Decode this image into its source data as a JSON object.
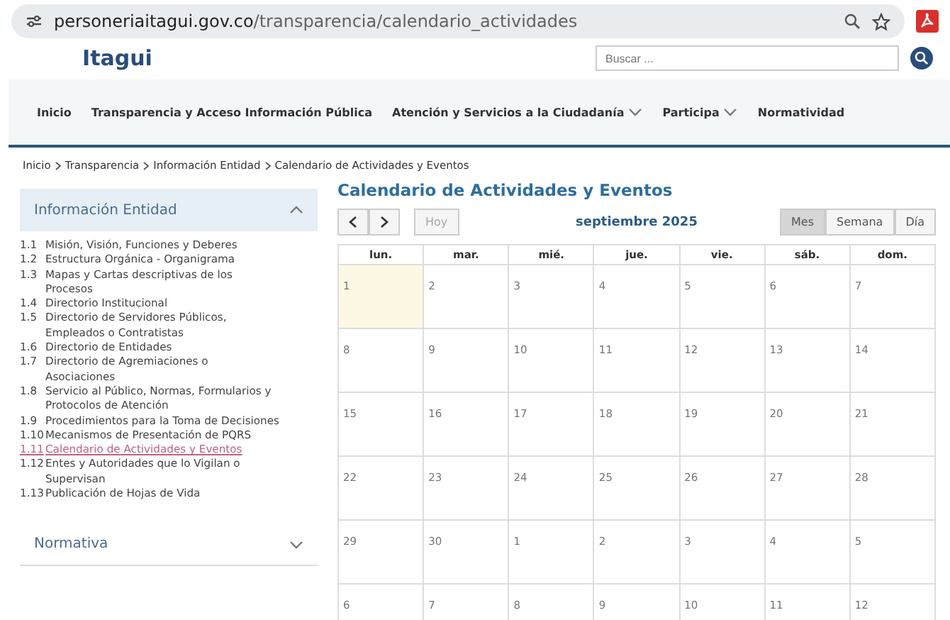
{
  "browser": {
    "url_host": "personeriaitagui.gov.co",
    "url_path": "/transparencia/calendario_actividades"
  },
  "header": {
    "brand": "Itagui",
    "search": {
      "placeholder": "Buscar ..."
    }
  },
  "nav": [
    {
      "label": "Inicio",
      "dropdown": false
    },
    {
      "label": "Transparencia y Acceso Información Pública",
      "dropdown": false
    },
    {
      "label": "Atención y Servicios a la Ciudadanía",
      "dropdown": true
    },
    {
      "label": "Participa",
      "dropdown": true
    },
    {
      "label": "Normatividad",
      "dropdown": false
    }
  ],
  "breadcrumb": [
    "Inicio",
    "Transparencia",
    "Información Entidad",
    "Calendario de Actividades y Eventos"
  ],
  "sidebar": {
    "sections": [
      {
        "title": "Información Entidad",
        "expanded": true,
        "items": [
          {
            "num": "1.1",
            "label": "Misión, Visión, Funciones y Deberes",
            "selected": false
          },
          {
            "num": "1.2",
            "label": "Estructura Orgánica - Organigrama",
            "selected": false
          },
          {
            "num": "1.3",
            "label": "Mapas y Cartas descriptivas de los Procesos",
            "selected": false
          },
          {
            "num": "1.4",
            "label": "Directorio Institucional",
            "selected": false
          },
          {
            "num": "1.5",
            "label": "Directorio de Servidores Públicos, Empleados o Contratistas",
            "selected": false
          },
          {
            "num": "1.6",
            "label": "Directorio de Entidades",
            "selected": false
          },
          {
            "num": "1.7",
            "label": "Directorio de Agremiaciones o Asociaciones",
            "selected": false
          },
          {
            "num": "1.8",
            "label": "Servicio al Público, Normas, Formularios y Protocolos de Atención",
            "selected": false
          },
          {
            "num": "1.9",
            "label": "Procedimientos para la Toma de Decisiones",
            "selected": false
          },
          {
            "num": "1.10",
            "label": "Mecanismos de Presentación de PQRS",
            "selected": false
          },
          {
            "num": "1.11",
            "label": "Calendario de Actividades y Eventos",
            "selected": true
          },
          {
            "num": "1.12",
            "label": "Entes y Autoridades que lo Vigilan o Supervisan",
            "selected": false
          },
          {
            "num": "1.13",
            "label": "Publicación de Hojas de Vida",
            "selected": false
          }
        ]
      },
      {
        "title": "Normativa",
        "expanded": false
      }
    ]
  },
  "calendar": {
    "title": "Calendario de Actividades y Eventos",
    "today_button": "Hoy",
    "month": "septiembre 2025",
    "views": [
      {
        "label": "Mes",
        "selected": true
      },
      {
        "label": "Semana",
        "selected": false
      },
      {
        "label": "Día",
        "selected": false
      }
    ],
    "weekdays": [
      "lun.",
      "mar.",
      "mié.",
      "jue.",
      "vie.",
      "sáb.",
      "dom."
    ],
    "weeks": [
      [
        {
          "day": "1",
          "today": true
        },
        {
          "day": "2",
          "today": false
        },
        {
          "day": "3",
          "today": false
        },
        {
          "day": "4",
          "today": false
        },
        {
          "day": "5",
          "today": false
        },
        {
          "day": "6",
          "today": false
        },
        {
          "day": "7",
          "today": false
        }
      ],
      [
        {
          "day": "8",
          "today": false
        },
        {
          "day": "9",
          "today": false
        },
        {
          "day": "10",
          "today": false
        },
        {
          "day": "11",
          "today": false
        },
        {
          "day": "12",
          "today": false
        },
        {
          "day": "13",
          "today": false
        },
        {
          "day": "14",
          "today": false
        }
      ],
      [
        {
          "day": "15",
          "today": false
        },
        {
          "day": "16",
          "today": false
        },
        {
          "day": "17",
          "today": false
        },
        {
          "day": "18",
          "today": false
        },
        {
          "day": "19",
          "today": false
        },
        {
          "day": "20",
          "today": false
        },
        {
          "day": "21",
          "today": false
        }
      ],
      [
        {
          "day": "22",
          "today": false
        },
        {
          "day": "23",
          "today": false
        },
        {
          "day": "24",
          "today": false
        },
        {
          "day": "25",
          "today": false
        },
        {
          "day": "26",
          "today": false
        },
        {
          "day": "27",
          "today": false
        },
        {
          "day": "28",
          "today": false
        }
      ],
      [
        {
          "day": "29",
          "today": false
        },
        {
          "day": "30",
          "today": false
        },
        {
          "day": "1",
          "today": false
        },
        {
          "day": "2",
          "today": false
        },
        {
          "day": "3",
          "today": false
        },
        {
          "day": "4",
          "today": false
        },
        {
          "day": "5",
          "today": false
        }
      ],
      [
        {
          "day": "6",
          "today": false
        },
        {
          "day": "7",
          "today": false
        },
        {
          "day": "8",
          "today": false
        },
        {
          "day": "9",
          "today": false
        },
        {
          "day": "10",
          "today": false
        },
        {
          "day": "11",
          "today": false
        },
        {
          "day": "12",
          "today": false
        }
      ]
    ]
  }
}
